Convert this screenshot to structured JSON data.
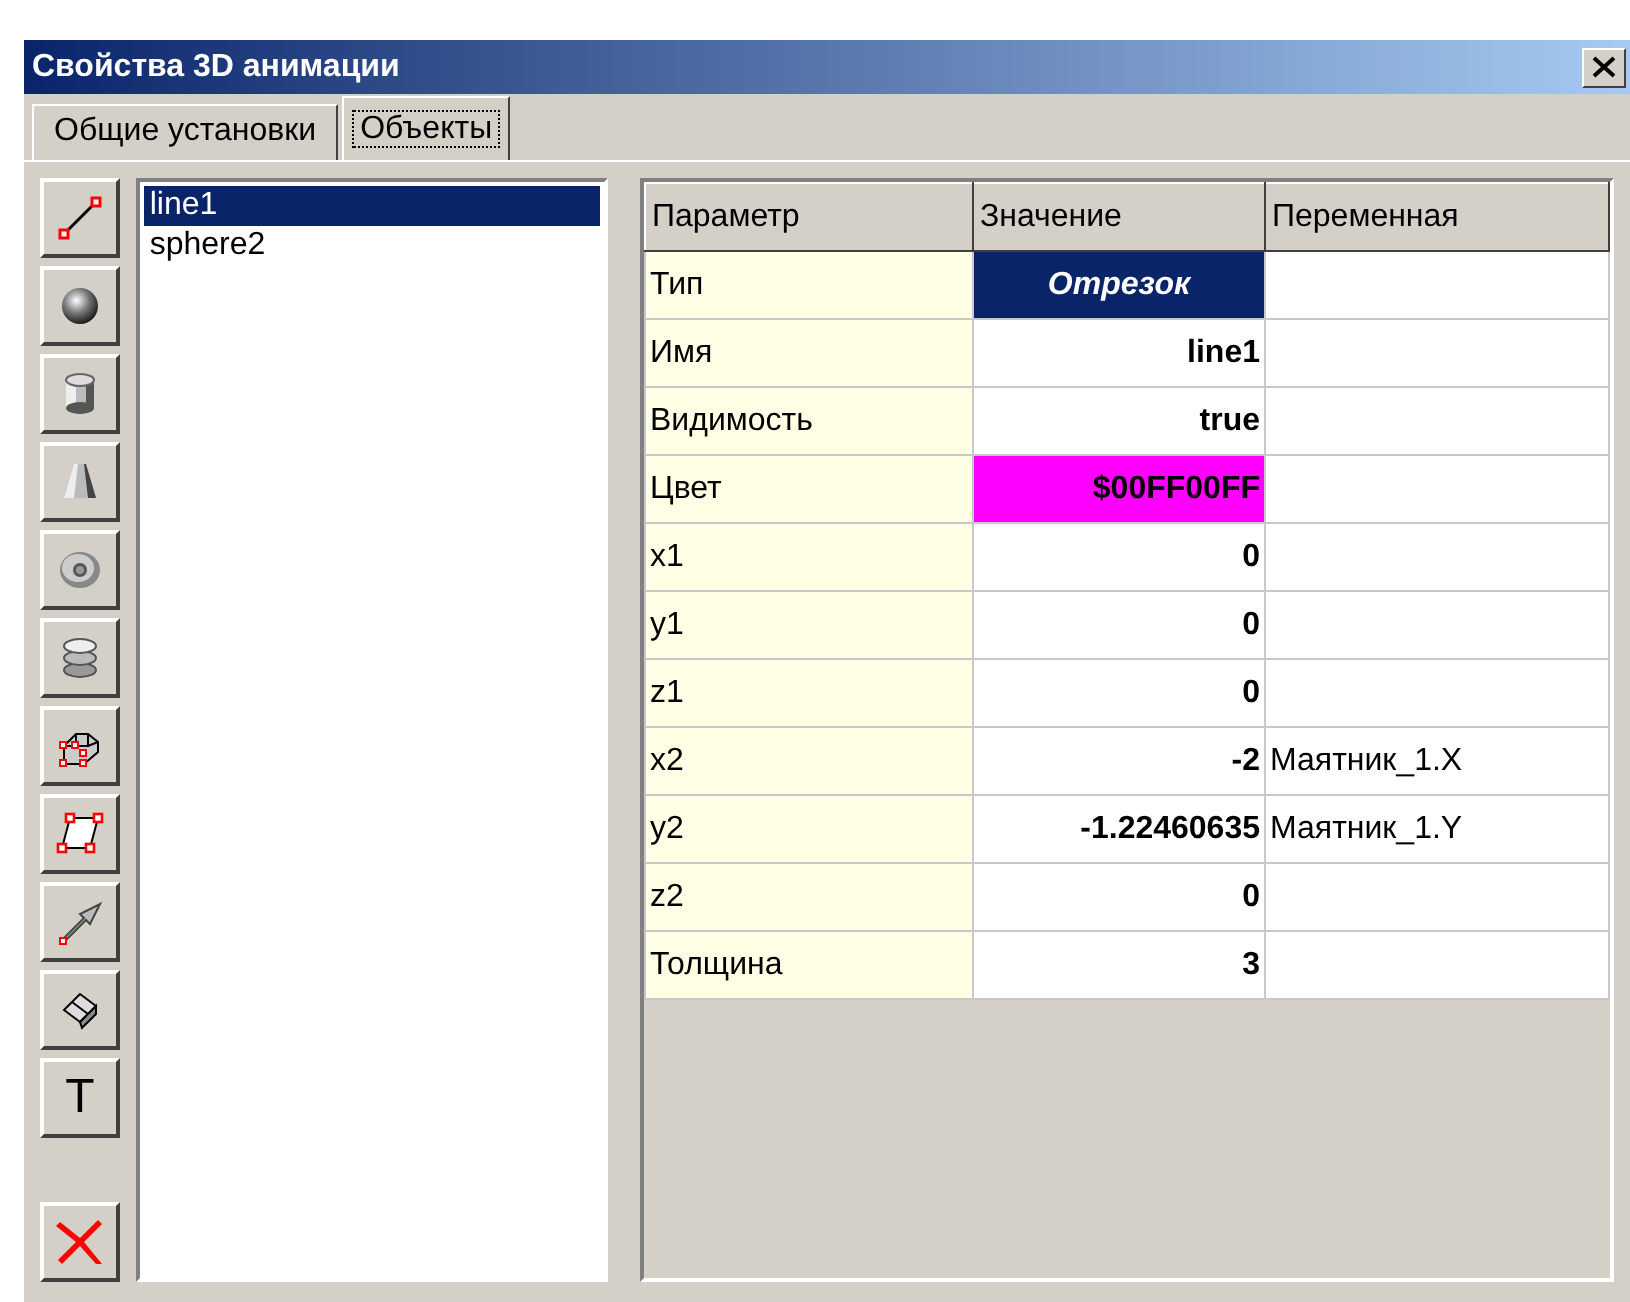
{
  "window": {
    "title": "Свойства 3D анимации"
  },
  "tabs": [
    {
      "label": "Общие установки",
      "selected": false
    },
    {
      "label": "Объекты",
      "selected": true
    }
  ],
  "toolbar": [
    {
      "kind": "line"
    },
    {
      "kind": "sphere"
    },
    {
      "kind": "cylinder"
    },
    {
      "kind": "cone"
    },
    {
      "kind": "torus"
    },
    {
      "kind": "stack"
    },
    {
      "kind": "extrusion"
    },
    {
      "kind": "plane"
    },
    {
      "kind": "arrow"
    },
    {
      "kind": "surface"
    },
    {
      "kind": "text",
      "label": "T"
    },
    {
      "kind": "delete"
    }
  ],
  "objects": [
    {
      "name": "line1",
      "selected": true
    },
    {
      "name": "sphere2",
      "selected": false
    }
  ],
  "table": {
    "columns": [
      "Параметр",
      "Значение",
      "Переменная"
    ],
    "rows": [
      {
        "parameter": "Тип",
        "value": "Отрезок",
        "kind": "type"
      },
      {
        "parameter": "Имя",
        "value": "line1",
        "kind": "value"
      },
      {
        "parameter": "Видимость",
        "value": "true",
        "kind": "value"
      },
      {
        "parameter": "Цвет",
        "value": "$00FF00FF",
        "kind": "color",
        "color": "#ff00ff"
      },
      {
        "parameter": "x1",
        "value": "0",
        "kind": "value"
      },
      {
        "parameter": "y1",
        "value": "0",
        "kind": "value"
      },
      {
        "parameter": "z1",
        "value": "0",
        "kind": "value"
      },
      {
        "parameter": "x2",
        "value": "-2",
        "kind": "value",
        "variable": "Маятник_1.X"
      },
      {
        "parameter": "y2",
        "value": "-1.22460635",
        "kind": "value",
        "variable": "Маятник_1.Y"
      },
      {
        "parameter": "z2",
        "value": "0",
        "kind": "value"
      },
      {
        "parameter": "Толщина",
        "value": "3",
        "kind": "value"
      }
    ]
  }
}
